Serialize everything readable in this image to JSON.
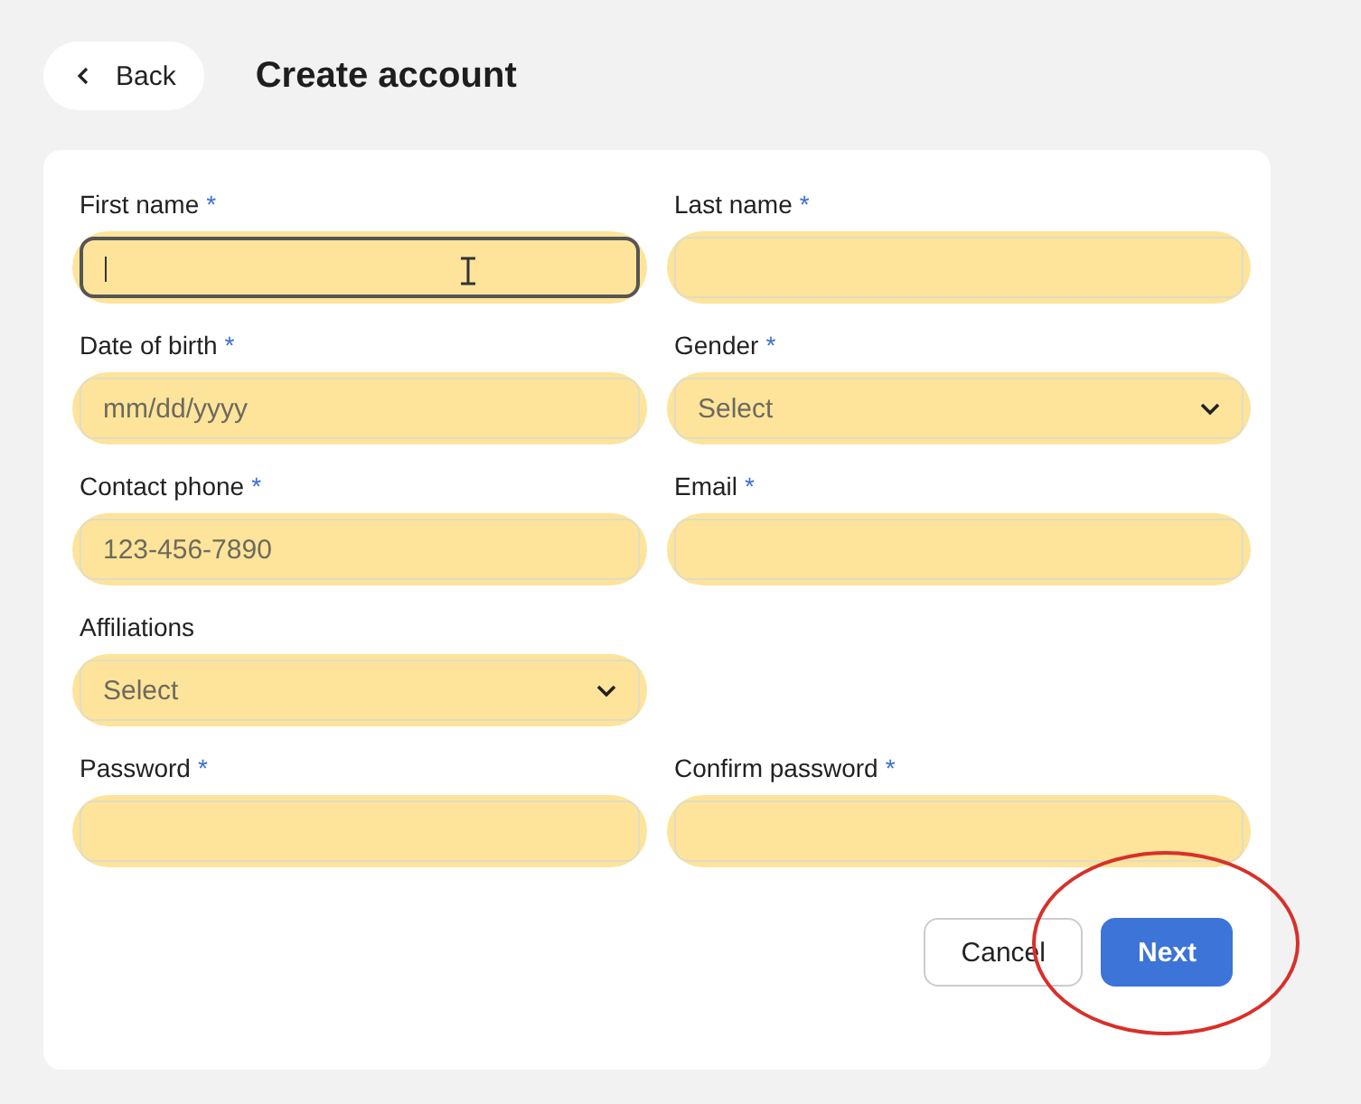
{
  "header": {
    "back_label": "Back",
    "title": "Create account"
  },
  "rows": [
    [
      {
        "label": "First name",
        "required_mark": "*",
        "kind": "text",
        "focused": true,
        "highlighted": true
      },
      {
        "label": "Last name",
        "required_mark": "*",
        "kind": "text",
        "focused": false,
        "highlighted": true
      }
    ],
    [
      {
        "label": "Date of birth",
        "required_mark": "*",
        "kind": "text",
        "placeholder": "mm/dd/yyyy",
        "focused": false,
        "highlighted": true
      },
      {
        "label": "Gender",
        "required_mark": "*",
        "kind": "select",
        "placeholder": "Select",
        "focused": false,
        "highlighted": true
      }
    ],
    [
      {
        "label": "Contact phone",
        "required_mark": "*",
        "kind": "text",
        "placeholder": "123-456-7890",
        "focused": false,
        "highlighted": true
      },
      {
        "label": "Email",
        "required_mark": "*",
        "kind": "text",
        "focused": false,
        "highlighted": true
      }
    ],
    [
      {
        "label": "Affiliations",
        "kind": "select",
        "placeholder": "Select",
        "focused": false,
        "highlighted": true
      }
    ],
    [
      {
        "label": "Password",
        "required_mark": "*",
        "kind": "text",
        "focused": false,
        "highlighted": true
      },
      {
        "label": "Confirm password",
        "required_mark": "*",
        "kind": "text",
        "focused": false,
        "highlighted": true
      }
    ]
  ],
  "buttons": [
    {
      "label": "Cancel",
      "kind": "secondary",
      "circled": false
    },
    {
      "label": "Next",
      "kind": "primary",
      "circled": true
    }
  ]
}
